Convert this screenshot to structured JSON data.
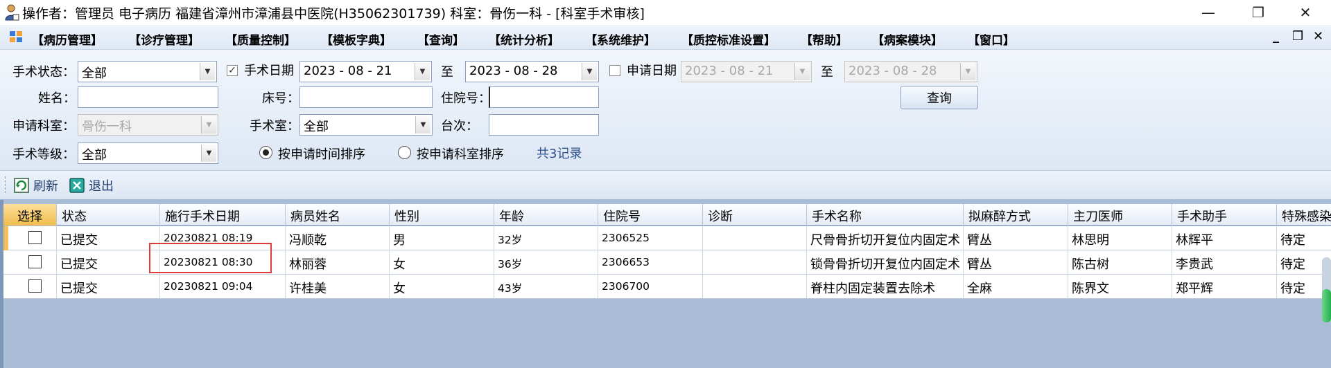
{
  "title_bar": {
    "text": "操作者：管理员 电子病历  福建省漳州市漳浦县中医院(H35062301739)  科室：骨伤一科 - [科室手术审核]",
    "controls": {
      "minimize": "—",
      "restore": "❐",
      "close": "✕"
    }
  },
  "menu": {
    "items": [
      "【病历管理】",
      "【诊疗管理】",
      "【质量控制】",
      "【模板字典】",
      "【查询】",
      "【统计分析】",
      "【系统维护】",
      "【质控标准设置】",
      "【帮助】",
      "【病案模块】",
      "【窗口】"
    ],
    "mdi_controls": {
      "minimize": "_",
      "restore": "❐",
      "close": "✕"
    }
  },
  "filters": {
    "surgery_status_label": "手术状态：",
    "surgery_status_value": "全部",
    "surgery_date_label": "手术日期",
    "surgery_date_checked": true,
    "surgery_date_from": "2023 - 08 - 21",
    "to_label_1": "至",
    "surgery_date_to": "2023 - 08 - 28",
    "apply_date_label": "申请日期",
    "apply_date_checked": false,
    "apply_date_from": "2023 - 08 - 21",
    "to_label_2": "至",
    "apply_date_to": "2023 - 08 - 28",
    "name_label": "姓名：",
    "name_value": "",
    "bed_label": "床号：",
    "bed_value": "",
    "inpatient_no_label": "住院号：",
    "inpatient_no_value": "",
    "query_button": "查询",
    "apply_dept_label": "申请科室：",
    "apply_dept_value": "骨伤一科",
    "or_room_label": "手术室：",
    "or_room_value": "全部",
    "table_no_label": "台次：",
    "table_no_value": "",
    "surgery_level_label": "手术等级：",
    "surgery_level_value": "全部",
    "sort_by_time_label": "按申请时间排序",
    "sort_by_dept_label": "按申请科室排序",
    "sort_selected": "time",
    "record_count": "共3记录"
  },
  "toolbar": {
    "refresh_label": "刷新",
    "exit_label": "退出"
  },
  "table": {
    "columns": [
      "选择",
      "状态",
      "施行手术日期",
      "病员姓名",
      "性别",
      "年龄",
      "住院号",
      "诊断",
      "手术名称",
      "拟麻醉方式",
      "主刀医师",
      "手术助手",
      "特殊感染"
    ],
    "rows": [
      {
        "selected": false,
        "status": "已提交",
        "date": "20230821  08:19",
        "name": "冯顺乾",
        "sex": "男",
        "age": "32岁",
        "inpatient_no": "2306525",
        "diagnosis": "",
        "surgery": "尺骨骨折切开复位内固定术",
        "anesthesia": "臂丛",
        "surgeon": "林思明",
        "assistant": "林辉平",
        "infection": "待定"
      },
      {
        "selected": false,
        "status": "已提交",
        "date": "20230821  08:30",
        "name": "林丽蓉",
        "sex": "女",
        "age": "36岁",
        "inpatient_no": "2306653",
        "diagnosis": "",
        "surgery": "锁骨骨折切开复位内固定术",
        "anesthesia": "臂丛",
        "surgeon": "陈古树",
        "assistant": "李贵武",
        "infection": "待定"
      },
      {
        "selected": false,
        "status": "已提交",
        "date": "20230821  09:04",
        "name": "许桂美",
        "sex": "女",
        "age": "43岁",
        "inpatient_no": "2306700",
        "diagnosis": "",
        "surgery": "脊柱内固定装置去除术",
        "anesthesia": "全麻",
        "surgeon": "陈界文",
        "assistant": "郑平辉",
        "infection": "待定"
      }
    ]
  },
  "colors": {
    "accent_header_select": "#f2bd4c",
    "highlight_box": "#e03a3a",
    "grid_background": "#a9bdd6",
    "scroll_thumb": "#22b14c"
  }
}
